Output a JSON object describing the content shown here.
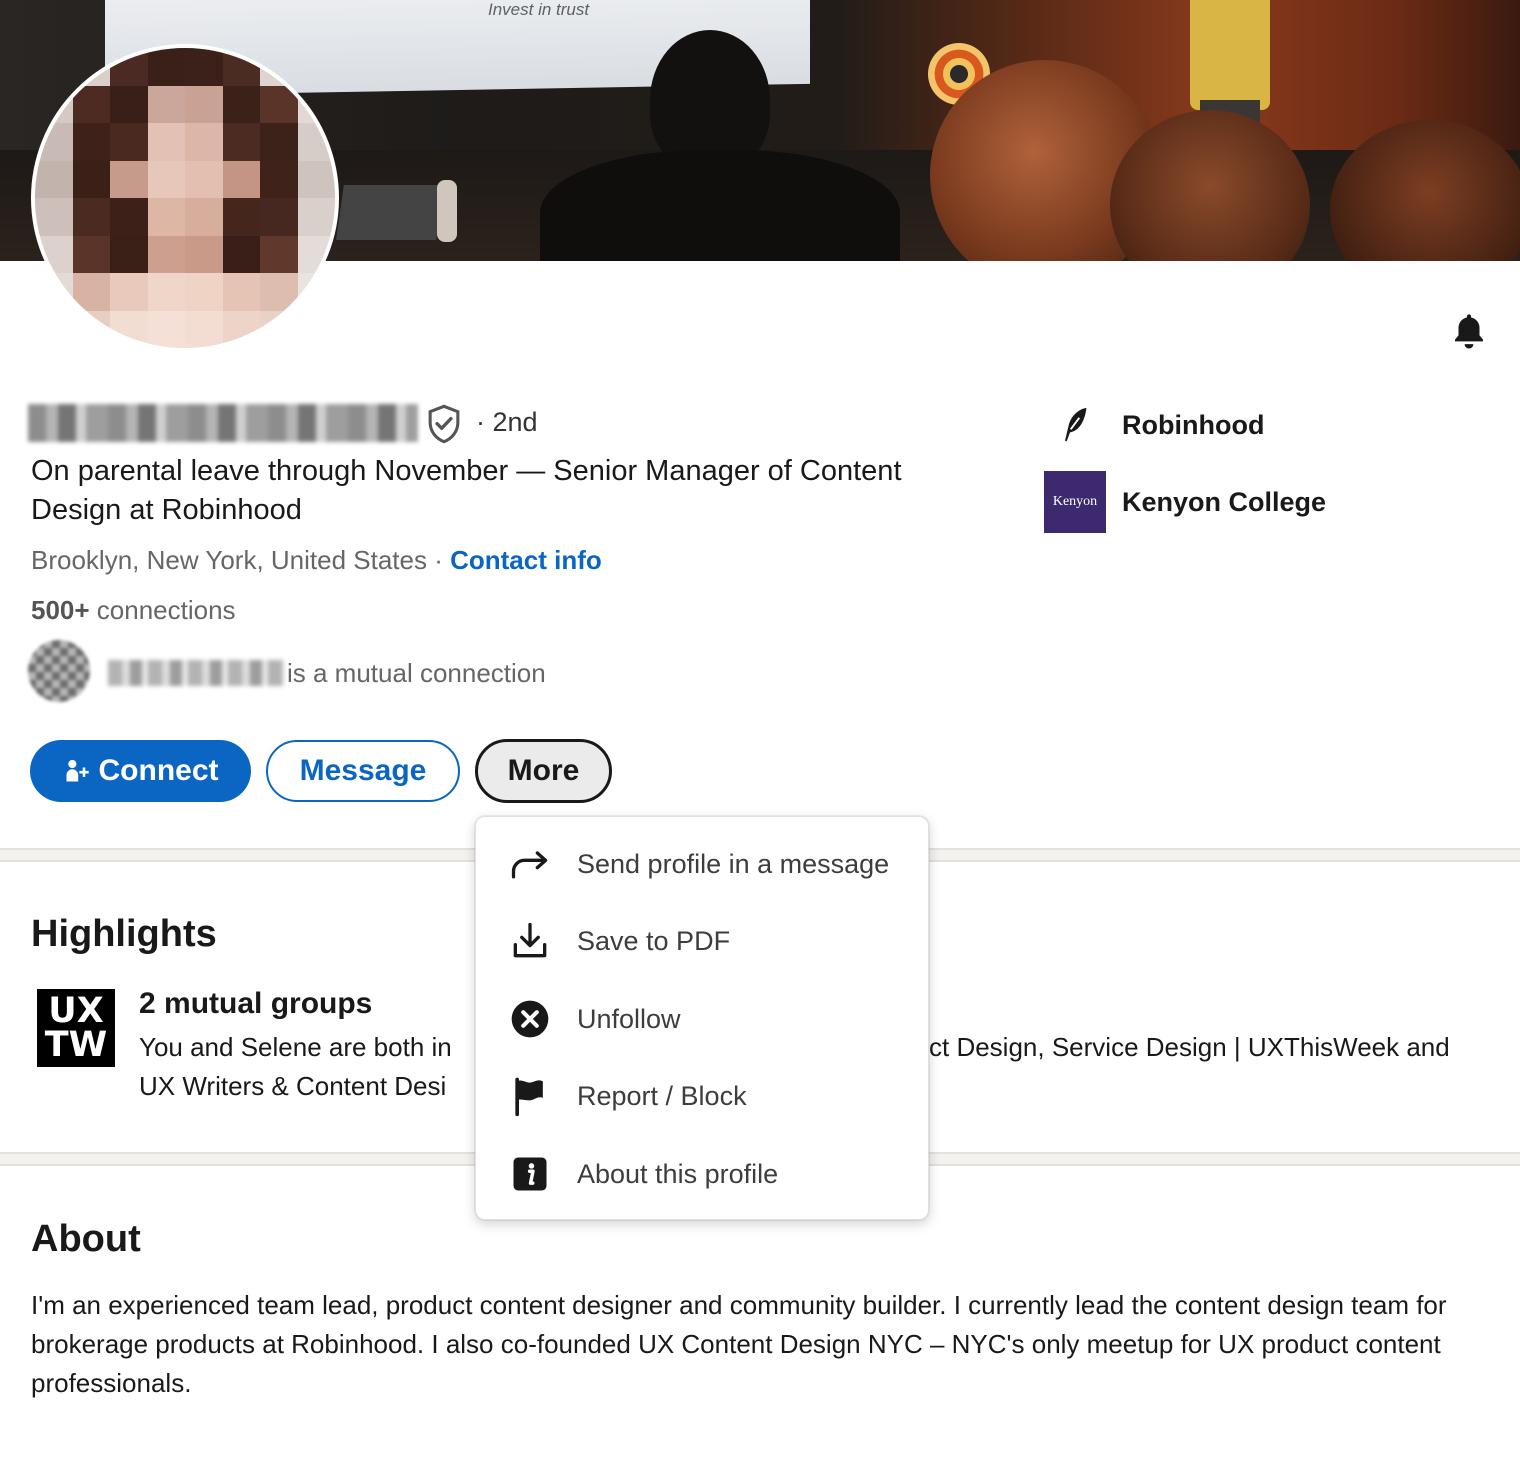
{
  "banner": {
    "screen_text": "Invest in trust"
  },
  "profile": {
    "degree": "· 2nd",
    "headline": "On parental leave through November — Senior Manager of Content Design at Robinhood",
    "location": "Brooklyn, New York, United States",
    "location_separator": " · ",
    "contact_info_label": "Contact info",
    "connections_count": "500+",
    "connections_label": " connections",
    "mutual_text": "is a mutual connection"
  },
  "actions": {
    "connect_label": "Connect",
    "message_label": "Message",
    "more_label": "More"
  },
  "more_menu": {
    "items": [
      {
        "label": "Send profile in a message",
        "icon": "share-arrow-icon"
      },
      {
        "label": "Save to PDF",
        "icon": "download-icon"
      },
      {
        "label": "Unfollow",
        "icon": "close-circle-icon"
      },
      {
        "label": "Report / Block",
        "icon": "flag-icon"
      },
      {
        "label": "About this profile",
        "icon": "info-icon"
      }
    ]
  },
  "experience_summary": {
    "company": "Robinhood",
    "school": "Kenyon College",
    "school_logo_text": "Kenyon"
  },
  "highlights": {
    "title": "Highlights",
    "logo_line1": "UX",
    "logo_line2": "TW",
    "groups_title": "2 mutual groups",
    "groups_desc_start": "You and Selene are both in",
    "groups_desc_hidden_right": "ct Design, Service Design | UXThisWeek and",
    "groups_desc_line2": "UX Writers & Content Desi"
  },
  "about": {
    "title": "About",
    "text": "I'm an experienced team lead, product content designer and community builder. I currently lead the content design team for brokerage products at Robinhood. I also co-founded UX Content Design NYC – NYC's only meetup for UX product content professionals."
  }
}
